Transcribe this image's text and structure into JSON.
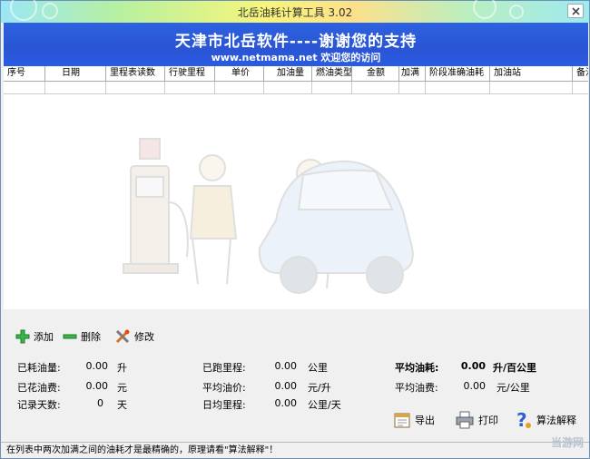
{
  "window": {
    "title": "北岳油耗计算工具 3.02"
  },
  "banner": {
    "title": "天津市北岳软件----谢谢您的支持",
    "subtitle": "www.netmama.net 欢迎您的访问"
  },
  "table": {
    "columns": [
      "序号",
      "日期",
      "里程表读数",
      "行驶里程",
      "单价",
      "加油量",
      "燃油类型",
      "金额",
      "加满",
      "阶段准确油耗",
      "加油站",
      "备注"
    ]
  },
  "toolbar": {
    "add": "添加",
    "delete": "删除",
    "edit": "修改"
  },
  "stats": {
    "fuel_used_label": "已耗油量:",
    "fuel_used_value": "0.00",
    "fuel_used_unit": "升",
    "fuel_cost_label": "已花油费:",
    "fuel_cost_value": "0.00",
    "fuel_cost_unit": "元",
    "record_days_label": "记录天数:",
    "record_days_value": "0",
    "record_days_unit": "天",
    "distance_label": "已跑里程:",
    "distance_value": "0.00",
    "distance_unit": "公里",
    "avg_price_label": "平均油价:",
    "avg_price_value": "0.00",
    "avg_price_unit": "元/升",
    "daily_mileage_label": "日均里程:",
    "daily_mileage_value": "0.00",
    "daily_mileage_unit": "公里/天",
    "avg_consumption_label": "平均油耗:",
    "avg_consumption_value": "0.00",
    "avg_consumption_unit": "升/百公里",
    "avg_fuel_fee_label": "平均油费:",
    "avg_fuel_fee_value": "0.00",
    "avg_fuel_fee_unit": "元/公里"
  },
  "actions": {
    "export": "导出",
    "print": "打印",
    "explain": "算法解释"
  },
  "status": {
    "text": "在列表中两次加满之间的油耗才是最精确的，原理请看\"算法解释\"！"
  },
  "watermark": {
    "text": "当游网"
  }
}
